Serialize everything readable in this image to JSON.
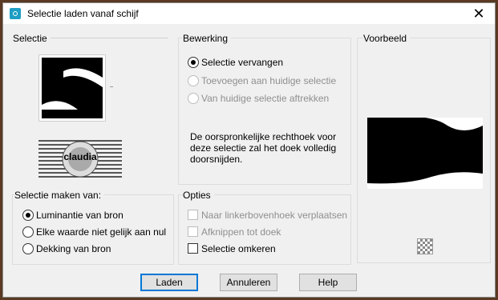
{
  "window": {
    "title": "Selectie laden vanaf schijf"
  },
  "selectie": {
    "label": "Selectie",
    "thumb_caption": "claudia"
  },
  "bewerking": {
    "label": "Bewerking",
    "options": [
      {
        "label": "Selectie vervangen",
        "selected": true,
        "enabled": true
      },
      {
        "label": "Toevoegen aan huidige selectie",
        "selected": false,
        "enabled": false
      },
      {
        "label": "Van huidige selectie aftrekken",
        "selected": false,
        "enabled": false
      }
    ],
    "description": "De oorspronkelijke rechthoek voor deze selectie zal het doek volledig doorsnijden."
  },
  "voorbeeld": {
    "label": "Voorbeeld"
  },
  "maken_van": {
    "label": "Selectie maken van:",
    "options": [
      {
        "label": "Luminantie van bron",
        "selected": true
      },
      {
        "label": "Elke waarde niet gelijk aan nul",
        "selected": false
      },
      {
        "label": "Dekking van bron",
        "selected": false
      }
    ]
  },
  "opties": {
    "label": "Opties",
    "checks": [
      {
        "label": "Naar linkerbovenhoek verplaatsen",
        "checked": false,
        "enabled": false
      },
      {
        "label": "Afknippen tot doek",
        "checked": false,
        "enabled": false
      },
      {
        "label": "Selectie omkeren",
        "checked": false,
        "enabled": true
      }
    ]
  },
  "buttons": {
    "load": "Laden",
    "cancel": "Annuleren",
    "help": "Help"
  }
}
